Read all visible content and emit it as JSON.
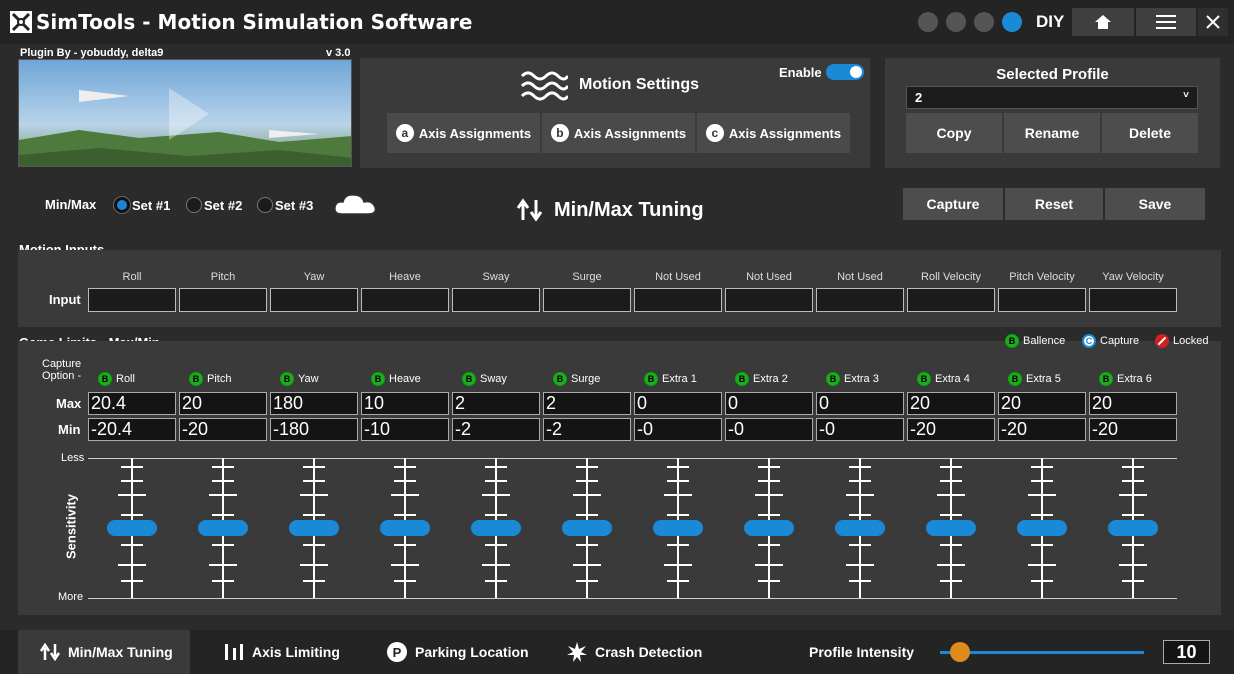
{
  "app": {
    "title": "SimTools - Motion Simulation Software",
    "mode": "DIY"
  },
  "plugin": {
    "author": "Plugin By - yobuddy, delta9",
    "version": "v 3.0"
  },
  "motion_settings": {
    "title": "Motion Settings",
    "enable_label": "Enable",
    "enabled": true,
    "axis_buttons": [
      {
        "icon": "a",
        "label": "Axis Assignments"
      },
      {
        "icon": "b",
        "label": "Axis Assignments"
      },
      {
        "icon": "c",
        "label": "Axis Assignments"
      }
    ]
  },
  "profile": {
    "title": "Selected Profile",
    "value": "2",
    "buttons": {
      "copy": "Copy",
      "rename": "Rename",
      "delete": "Delete"
    }
  },
  "minmax": {
    "label": "Min/Max",
    "sets": [
      "Set #1",
      "Set #2",
      "Set #3"
    ],
    "selected_set": 0,
    "heading": "Min/Max Tuning",
    "buttons": {
      "capture": "Capture",
      "reset": "Reset",
      "save": "Save"
    }
  },
  "motion_inputs": {
    "title": "Motion Inputs",
    "row_label": "Input",
    "columns": [
      "Roll",
      "Pitch",
      "Yaw",
      "Heave",
      "Sway",
      "Surge",
      "Not Used",
      "Not Used",
      "Not Used",
      "Roll Velocity",
      "Pitch Velocity",
      "Yaw Velocity"
    ]
  },
  "game_limits": {
    "title": "Game Limits - Max/Min",
    "legend": [
      {
        "icon": "B",
        "label": "Ballence",
        "color": "#22aa22"
      },
      {
        "icon": "C",
        "label": "Capture",
        "color": "#1a8ad6"
      },
      {
        "icon": "locked",
        "label": "Locked",
        "color": "#d02020"
      }
    ],
    "capture_label": "Capture Option -",
    "max_label": "Max",
    "min_label": "Min",
    "columns": [
      {
        "name": "Roll",
        "max": "20.4",
        "min": "-20.4"
      },
      {
        "name": "Pitch",
        "max": "20",
        "min": "-20"
      },
      {
        "name": "Yaw",
        "max": "180",
        "min": "-180"
      },
      {
        "name": "Heave",
        "max": "10",
        "min": "-10"
      },
      {
        "name": "Sway",
        "max": "2",
        "min": "-2"
      },
      {
        "name": "Surge",
        "max": "2",
        "min": "-2"
      },
      {
        "name": "Extra 1",
        "max": "0",
        "min": "-0"
      },
      {
        "name": "Extra 2",
        "max": "0",
        "min": "-0"
      },
      {
        "name": "Extra 3",
        "max": "0",
        "min": "-0"
      },
      {
        "name": "Extra 4",
        "max": "20",
        "min": "-20"
      },
      {
        "name": "Extra 5",
        "max": "20",
        "min": "-20"
      },
      {
        "name": "Extra 6",
        "max": "20",
        "min": "-20"
      }
    ],
    "sensitivity_label": "Sensitivity",
    "less_label": "Less",
    "more_label": "More",
    "sensitivity_level": 0.5
  },
  "bottom_tabs": [
    "Min/Max Tuning",
    "Axis Limiting",
    "Parking Location",
    "Crash Detection"
  ],
  "intensity": {
    "label": "Profile Intensity",
    "value": "10",
    "level": 0.1
  },
  "colors": {
    "accent": "#1a8ad6",
    "slider_knob": "#e08a1e"
  }
}
